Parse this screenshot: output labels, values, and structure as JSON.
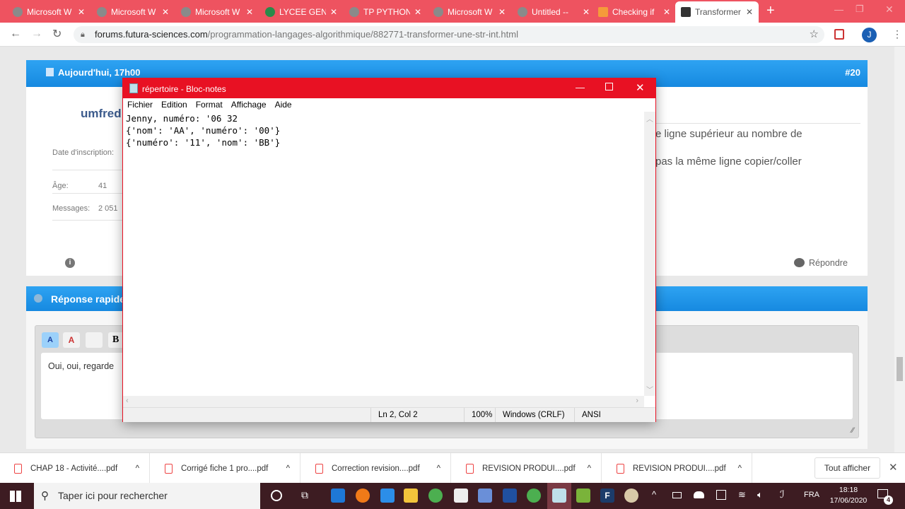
{
  "browser": {
    "tabs": [
      {
        "label": "Microsoft W",
        "active": false
      },
      {
        "label": "Microsoft W",
        "active": false
      },
      {
        "label": "Microsoft W",
        "active": false
      },
      {
        "label": "LYCEE GENE",
        "active": false
      },
      {
        "label": "TP PYTHON",
        "active": false
      },
      {
        "label": "Microsoft W",
        "active": false
      },
      {
        "label": "Untitled --",
        "active": false
      },
      {
        "label": "Checking if",
        "active": false
      },
      {
        "label": "Transformer",
        "active": true
      }
    ],
    "url_domain": "forums.futura-sciences.com",
    "url_path": "/programmation-langages-algorithmique/882771-transformer-une-str-int.html",
    "profile_initial": "J"
  },
  "post": {
    "date": "Aujourd'hui, 17h00",
    "number": "#20",
    "author": "umfred",
    "info": [
      {
        "label": "Date d'inscription:",
        "value": ""
      },
      {
        "label": "Âge:",
        "value": "41"
      },
      {
        "label": "Messages:",
        "value": "2 051"
      }
    ],
    "text_lines": [
      "e ligne supérieur au nombre de",
      "pas la même ligne copier/coller"
    ],
    "reply_label": "Répondre"
  },
  "quick_reply": {
    "title": "Réponse rapide",
    "editor_text": "Oui, oui, regarde"
  },
  "notepad": {
    "title": "répertoire - Bloc-notes",
    "menu": [
      "Fichier",
      "Edition",
      "Format",
      "Affichage",
      "Aide"
    ],
    "content": "Jenny, numéro: '06 32\n{'nom': 'AA', 'numéro': '00'}\n{'numéro': '11', 'nom': 'BB'}",
    "status": {
      "position": "Ln 2, Col 2",
      "zoom": "100%",
      "line_ending": "Windows (CRLF)",
      "encoding": "ANSI"
    }
  },
  "downloads": {
    "items": [
      "CHAP 18 - Activité....pdf",
      "Corrigé fiche 1 pro....pdf",
      "Correction revision....pdf",
      "REVISION PRODUI....pdf",
      "REVISION PRODUI....pdf"
    ],
    "show_all": "Tout afficher"
  },
  "taskbar": {
    "search_placeholder": "Taper ici pour rechercher",
    "language": "FRA",
    "time": "18:18",
    "date": "17/06/2020",
    "notifications": "4"
  }
}
